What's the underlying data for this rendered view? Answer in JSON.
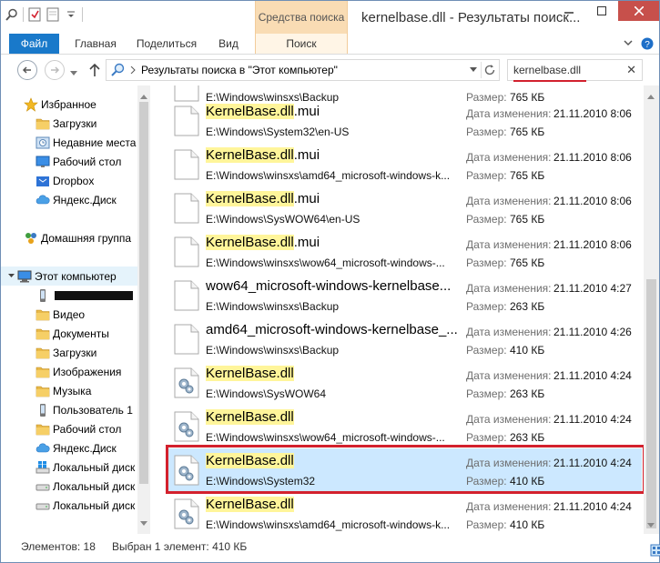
{
  "window": {
    "title": "kernelbase.dll - Результаты поиск...",
    "context_tab": "Средства поиска"
  },
  "ribbon": {
    "tabs": [
      "Файл",
      "Главная",
      "Поделиться",
      "Вид",
      "Поиск"
    ]
  },
  "address": {
    "path": "Результаты поиска в \"Этот компьютер\"",
    "search_value": "kernelbase.dll"
  },
  "nav": {
    "items": [
      {
        "label": "Избранное",
        "icon": "star-icon"
      },
      {
        "label": "Загрузки",
        "icon": "folder-icon"
      },
      {
        "label": "Недавние места",
        "icon": "recent-icon"
      },
      {
        "label": "Рабочий стол",
        "icon": "desktop-icon"
      },
      {
        "label": "Dropbox",
        "icon": "dropbox-icon"
      },
      {
        "label": "Яндекс.Диск",
        "icon": "cloud-icon"
      },
      {
        "label": "Домашняя группа",
        "icon": "homegroup-icon"
      },
      {
        "label": "Этот компьютер",
        "icon": "computer-icon"
      },
      {
        "label": "",
        "icon": "phone-icon"
      },
      {
        "label": "Видео",
        "icon": "folder-icon"
      },
      {
        "label": "Документы",
        "icon": "folder-icon"
      },
      {
        "label": "Загрузки",
        "icon": "folder-icon"
      },
      {
        "label": "Изображения",
        "icon": "folder-icon"
      },
      {
        "label": "Музыка",
        "icon": "folder-icon"
      },
      {
        "label": "Пользователь 1",
        "icon": "phone-icon"
      },
      {
        "label": "Рабочий стол",
        "icon": "folder-icon"
      },
      {
        "label": "Яндекс.Диск",
        "icon": "cloud-icon"
      },
      {
        "label": "Локальный диск",
        "icon": "windows-drive-icon"
      },
      {
        "label": "Локальный диск",
        "icon": "drive-icon"
      },
      {
        "label": "Локальный диск",
        "icon": "drive-icon"
      }
    ]
  },
  "labels": {
    "modified": "Дата изменения:",
    "size": "Размер:"
  },
  "results": [
    {
      "name_hl": "",
      "name_rest": "",
      "path": "E:\\Windows\\winsxs\\Backup",
      "date": "",
      "size": "765 КБ",
      "icon": "file-icon"
    },
    {
      "name_hl": "KernelBase.dll",
      "name_rest": ".mui",
      "path": "E:\\Windows\\System32\\en-US",
      "date": "21.11.2010 8:06",
      "size": "765 КБ",
      "icon": "file-icon"
    },
    {
      "name_hl": "KernelBase.dll",
      "name_rest": ".mui",
      "path": "E:\\Windows\\winsxs\\amd64_microsoft-windows-k...",
      "date": "21.11.2010 8:06",
      "size": "765 КБ",
      "icon": "file-icon"
    },
    {
      "name_hl": "KernelBase.dll",
      "name_rest": ".mui",
      "path": "E:\\Windows\\SysWOW64\\en-US",
      "date": "21.11.2010 8:06",
      "size": "765 КБ",
      "icon": "file-icon"
    },
    {
      "name_hl": "KernelBase.dll",
      "name_rest": ".mui",
      "path": "E:\\Windows\\winsxs\\wow64_microsoft-windows-...",
      "date": "21.11.2010 8:06",
      "size": "765 КБ",
      "icon": "file-icon"
    },
    {
      "name_hl": "",
      "name_rest": "wow64_microsoft-windows-kernelbase...",
      "path": "E:\\Windows\\winsxs\\Backup",
      "date": "21.11.2010 4:27",
      "size": "263 КБ",
      "icon": "file-icon"
    },
    {
      "name_hl": "",
      "name_rest": "amd64_microsoft-windows-kernelbase_...",
      "path": "E:\\Windows\\winsxs\\Backup",
      "date": "21.11.2010 4:26",
      "size": "410 КБ",
      "icon": "file-icon"
    },
    {
      "name_hl": "KernelBase.dll",
      "name_rest": "",
      "path": "E:\\Windows\\SysWOW64",
      "date": "21.11.2010 4:24",
      "size": "263 КБ",
      "icon": "dll-gear-icon"
    },
    {
      "name_hl": "KernelBase.dll",
      "name_rest": "",
      "path": "E:\\Windows\\winsxs\\wow64_microsoft-windows-...",
      "date": "21.11.2010 4:24",
      "size": "263 КБ",
      "icon": "dll-gear-icon"
    },
    {
      "name_hl": "KernelBase.dll",
      "name_rest": "",
      "path": "E:\\Windows\\System32",
      "date": "21.11.2010 4:24",
      "size": "410 КБ",
      "icon": "dll-gear-icon",
      "selected": true
    },
    {
      "name_hl": "KernelBase.dll",
      "name_rest": "",
      "path": "E:\\Windows\\winsxs\\amd64_microsoft-windows-k...",
      "date": "21.11.2010 4:24",
      "size": "410 КБ",
      "icon": "dll-gear-icon"
    }
  ],
  "status": {
    "count": "Элементов: 18",
    "selection": "Выбран 1 элемент: 410 КБ"
  }
}
